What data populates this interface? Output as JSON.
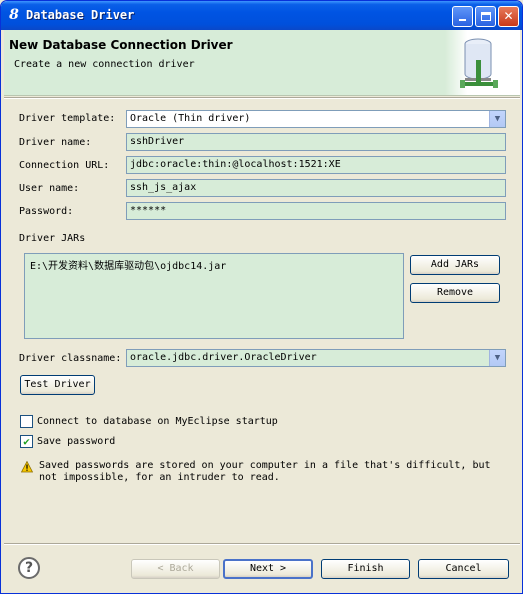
{
  "window": {
    "title": "Database Driver",
    "title_glyph": "8"
  },
  "header": {
    "title": "New Database Connection Driver",
    "subtitle": "Create a new connection driver"
  },
  "form": {
    "driver_template": {
      "label": "Driver template:",
      "value": "Oracle (Thin driver)"
    },
    "driver_name": {
      "label": "Driver name:",
      "value": "sshDriver"
    },
    "connection_url": {
      "label": "Connection URL:",
      "value": "jdbc:oracle:thin:@localhost:1521:XE"
    },
    "user_name": {
      "label": "User name:",
      "value": "ssh_js_ajax"
    },
    "password": {
      "label": "Password:",
      "value": "******"
    }
  },
  "driver_jars": {
    "label": "Driver JARs",
    "items": [
      "E:\\开发资料\\数据库驱动包\\ojdbc14.jar"
    ],
    "add_label": "Add JARs",
    "remove_label": "Remove"
  },
  "driver_classname": {
    "label": "Driver classname:",
    "value": "oracle.jdbc.driver.OracleDriver"
  },
  "test_driver_label": "Test Driver",
  "options": {
    "connect_on_startup": {
      "label": "Connect to database on MyEclipse startup",
      "checked": false
    },
    "save_password": {
      "label": "Save password",
      "checked": true
    }
  },
  "warning": "Saved passwords are stored on your computer in a file that's difficult, but not impossible, for an intruder to read.",
  "footer": {
    "help": "?",
    "back": "< Back",
    "next": "Next >",
    "finish": "Finish",
    "cancel": "Cancel"
  }
}
